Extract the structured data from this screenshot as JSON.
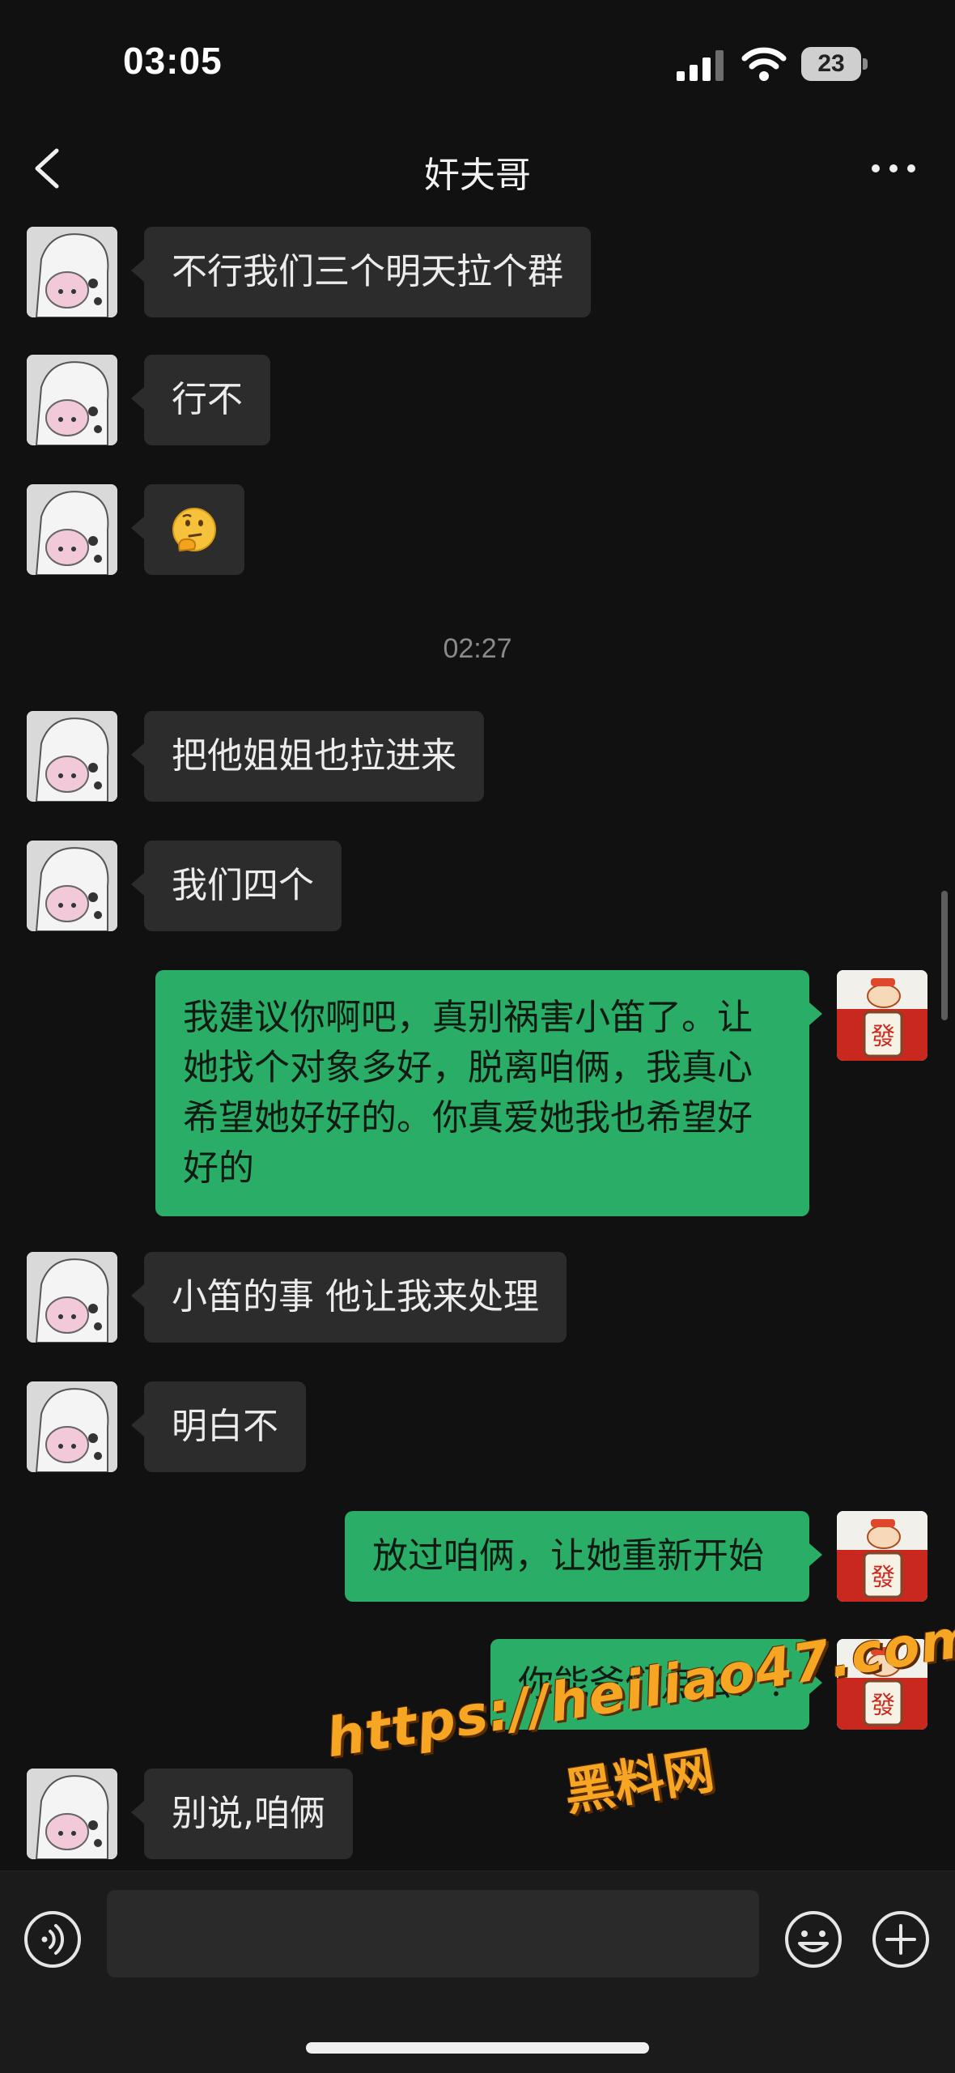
{
  "status_bar": {
    "time": "03:05",
    "battery": "23",
    "signal_icon": "cellular-signal-icon",
    "wifi_icon": "wifi-icon",
    "battery_icon": "battery-icon"
  },
  "nav": {
    "title": "奸夫哥",
    "back_icon": "chevron-left-icon",
    "more_icon": "more-dots-icon"
  },
  "chat": {
    "timestamp": "02:27",
    "messages": [
      {
        "side": "in",
        "text": "不行我们三个明天拉个群"
      },
      {
        "side": "in",
        "text": "行不"
      },
      {
        "side": "in",
        "text": "🤔"
      },
      {
        "side": "in",
        "text": "把他姐姐也拉进来"
      },
      {
        "side": "in",
        "text": "我们四个"
      },
      {
        "side": "out",
        "lines": [
          "我建议你啊吧，真别祸害小笛了。让",
          "她找个对象多好，脱离咱俩，我真心",
          "希望她好好的。你真爱她我也希望好",
          "好的"
        ]
      },
      {
        "side": "in",
        "text": "小笛的事 他让我来处理"
      },
      {
        "side": "in",
        "text": "明白不"
      },
      {
        "side": "out",
        "text": "放过咱俩，让她重新开始"
      },
      {
        "side": "out",
        "text": "你能爷们点么？！"
      },
      {
        "side": "in",
        "text": "别说,咱俩"
      }
    ]
  },
  "watermark": {
    "url": "https://heiliao47.com",
    "name": "黑料网"
  },
  "input_bar": {
    "voice_icon": "voice-icon",
    "emoji_icon": "emoji-icon",
    "plus_icon": "plus-icon",
    "input_value": ""
  },
  "colors": {
    "background": "#111111",
    "incoming_bubble": "#2c2c2c",
    "outgoing_bubble": "#2aae67",
    "watermark": "#f6a623"
  }
}
